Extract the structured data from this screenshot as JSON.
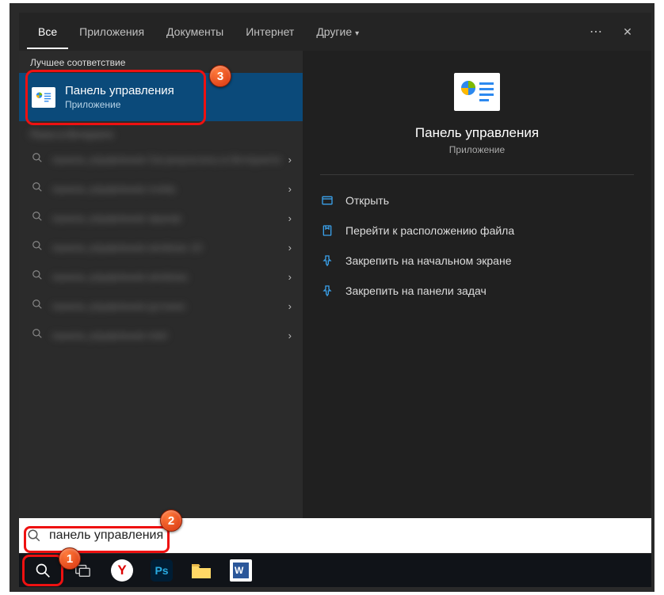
{
  "tabs": {
    "all": "Все",
    "apps": "Приложения",
    "documents": "Документы",
    "internet": "Интернет",
    "other": "Другие"
  },
  "sections": {
    "best_match": "Лучшее соответствие",
    "web_search": "Поиск в Интернете"
  },
  "best": {
    "title": "Панель управления",
    "subtitle": "Приложение"
  },
  "web_items": [
    "панель управления  См результаты в Интернете",
    "панель управления nvidia",
    "панель управления звуком",
    "панель управления windows 10",
    "панель управления windows",
    "панель управления рутокен",
    "панель управления intel"
  ],
  "detail": {
    "title": "Панель управления",
    "subtitle": "Приложение"
  },
  "actions": {
    "open": "Открыть",
    "goto": "Перейти к расположению файла",
    "pin_start": "Закрепить на начальном экране",
    "pin_task": "Закрепить на панели задач"
  },
  "search": {
    "value": "панель управления"
  },
  "badges": {
    "b1": "1",
    "b2": "2",
    "b3": "3"
  },
  "taskbar": {
    "yandex": "Y",
    "ps": "Ps",
    "word": "W"
  }
}
